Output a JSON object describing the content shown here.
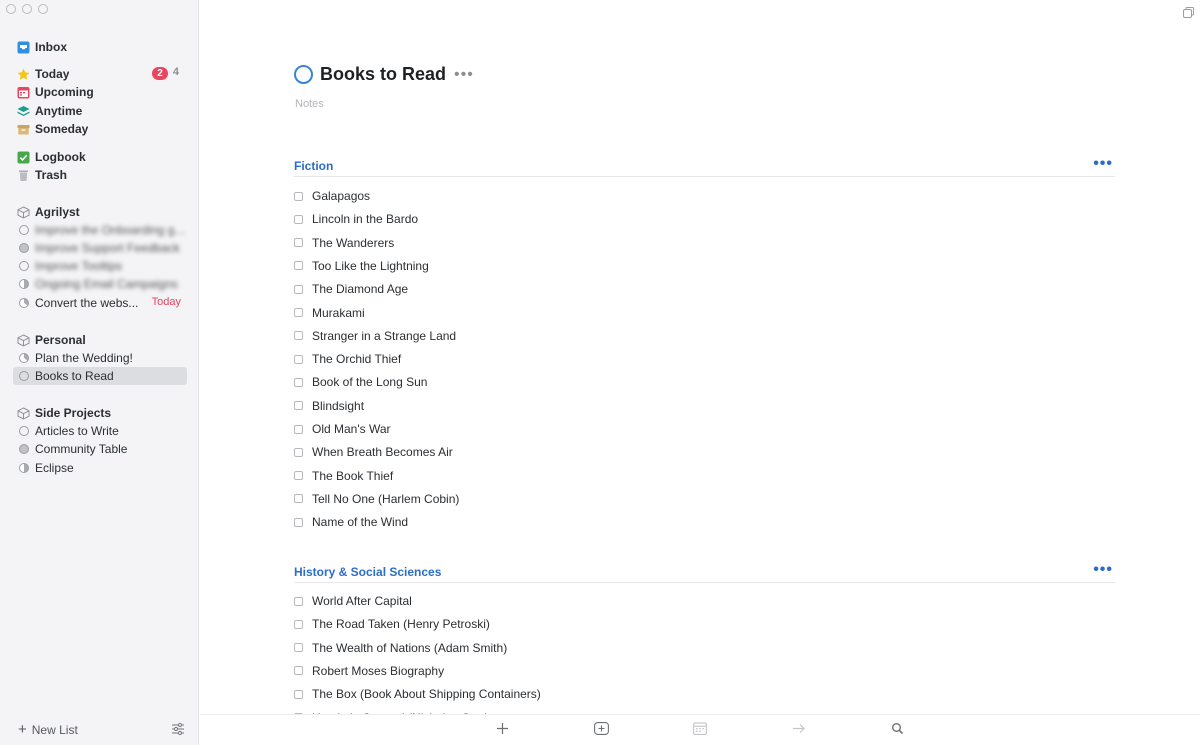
{
  "sidebar": {
    "inbox": "Inbox",
    "today": {
      "label": "Today",
      "due_count": "2",
      "count": "4"
    },
    "upcoming": "Upcoming",
    "anytime": "Anytime",
    "someday": "Someday",
    "logbook": "Logbook",
    "trash": "Trash",
    "areas": [
      {
        "name": "Agrilyst",
        "projects": [
          {
            "label": "Improve the Onboarding guide",
            "blurred": true
          },
          {
            "label": "Improve Support Feedback",
            "blurred": true
          },
          {
            "label": "Improve Tooltips",
            "blurred": true
          },
          {
            "label": "Ongoing Email Campaigns",
            "blurred": true
          },
          {
            "label": "Convert the webs...",
            "tag": "Today"
          }
        ]
      },
      {
        "name": "Personal",
        "projects": [
          {
            "label": "Plan the Wedding!"
          },
          {
            "label": "Books to Read",
            "selected": true
          }
        ]
      },
      {
        "name": "Side Projects",
        "projects": [
          {
            "label": "Articles to Write"
          },
          {
            "label": "Community Table"
          },
          {
            "label": "Eclipse"
          }
        ]
      }
    ],
    "new_list": "New List"
  },
  "project": {
    "title": "Books to Read",
    "notes_placeholder": "Notes",
    "headings": [
      {
        "title": "Fiction",
        "todos": [
          "Galapagos",
          "Lincoln in the Bardo",
          "The Wanderers",
          "Too Like the Lightning",
          "The Diamond Age",
          "Murakami",
          "Stranger in a Strange Land",
          "The Orchid Thief",
          "Book of the Long Sun",
          "Blindsight",
          "Old Man's War",
          "When Breath Becomes Air",
          "The Book Thief",
          "Tell No One (Harlem Cobin)",
          "Name of the Wind"
        ]
      },
      {
        "title": "History & Social Sciences",
        "todos": [
          "World After Capital",
          "The Road Taken (Henry Petroski)",
          "The Wealth of Nations (Adam Smith)",
          "Robert Moses Biography",
          "The Box (Book About Shipping Containers)",
          "Utopia is Created (Nicholas Carr)"
        ]
      }
    ]
  },
  "colors": {
    "accent": "#3b83d6",
    "heading": "#2b6ec8",
    "due": "#e8455f",
    "sidebar_bg": "#f4f4f6"
  },
  "toolbar_icons": [
    "plus-icon",
    "add-heading-icon",
    "calendar-icon",
    "move-arrow-icon",
    "search-icon"
  ]
}
